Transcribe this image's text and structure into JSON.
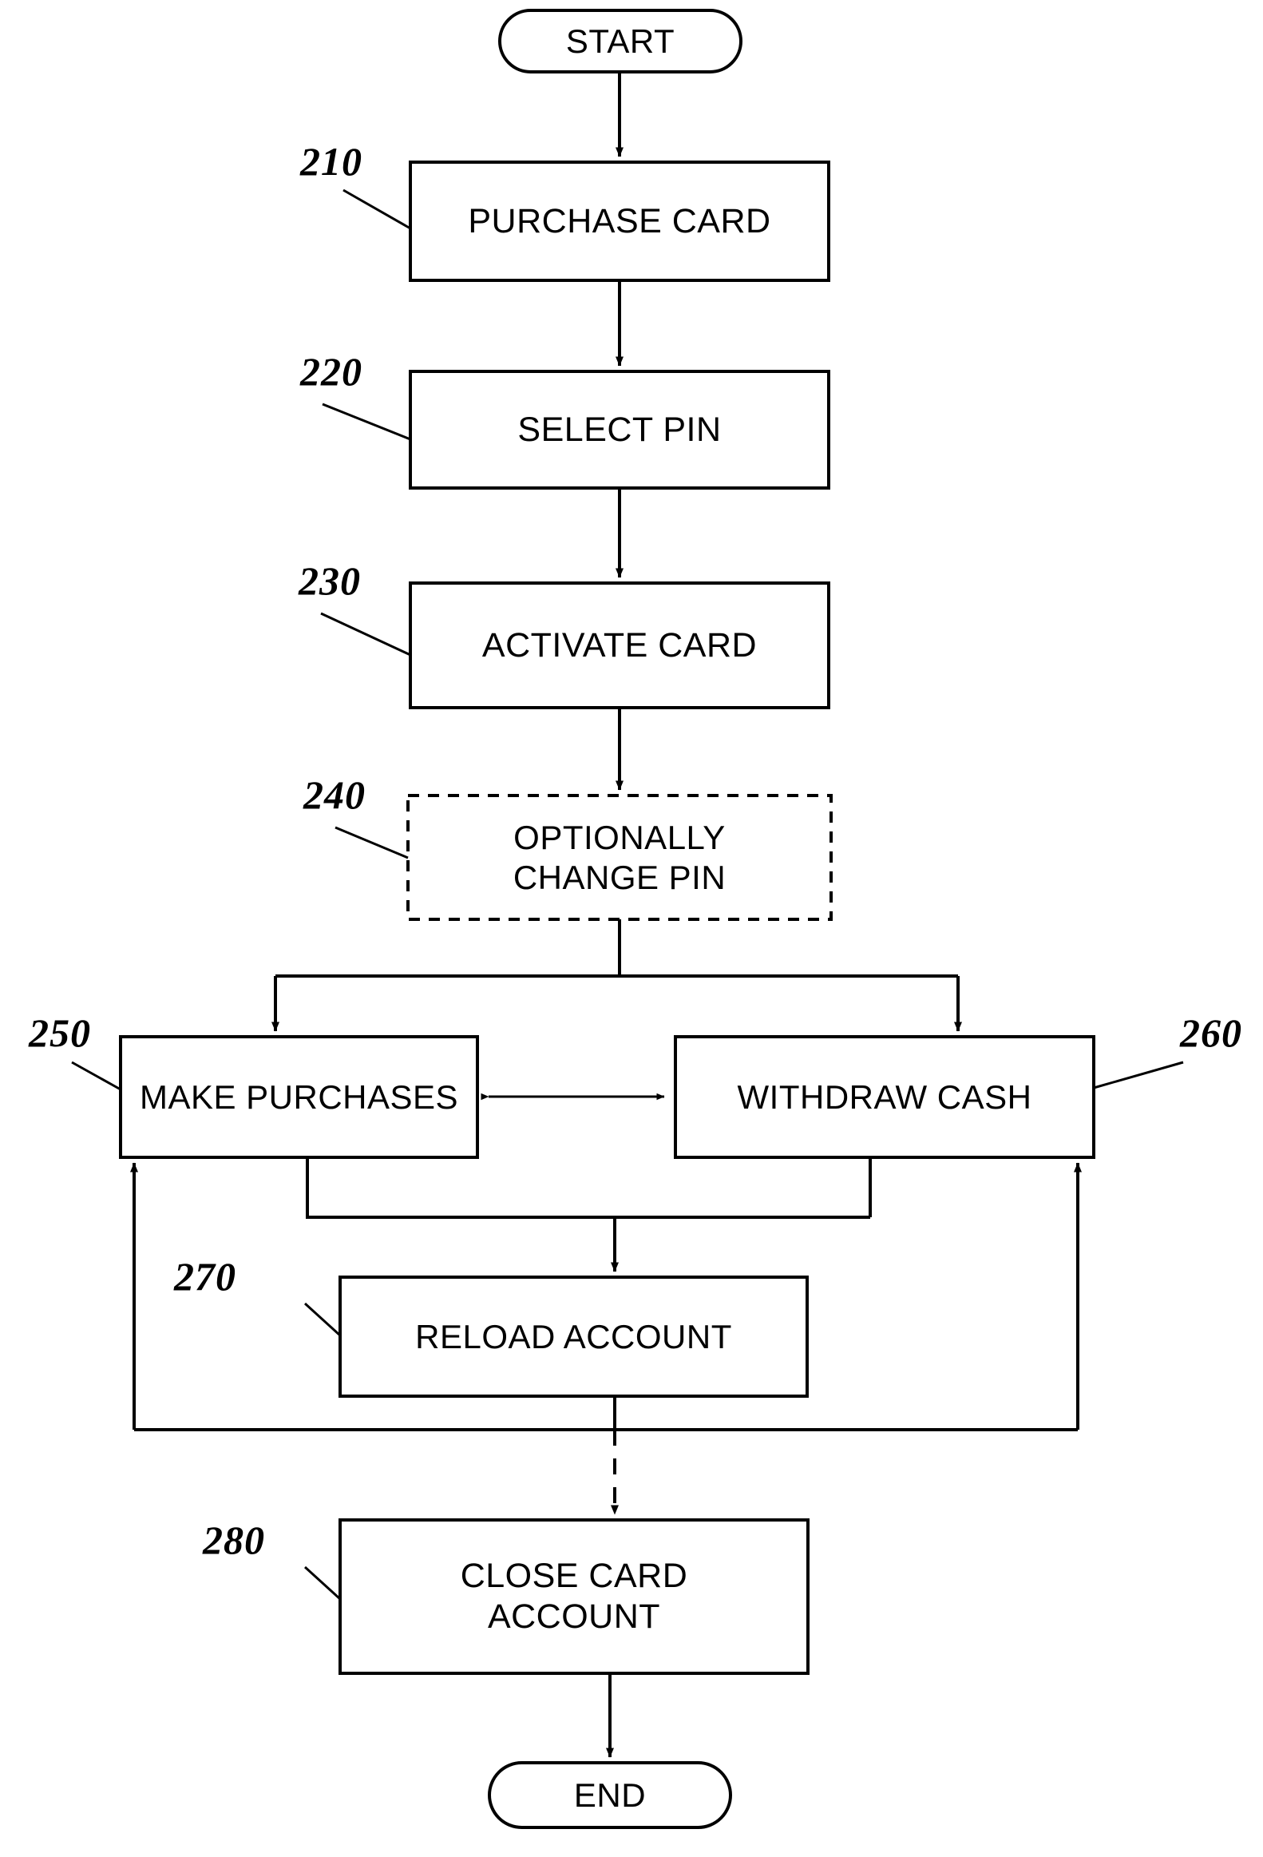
{
  "figure": {
    "type": "flowchart",
    "orientation": "vertical",
    "line_color": "#000000",
    "background_color": "#ffffff"
  },
  "nodes": {
    "start": {
      "label": "START",
      "shape": "terminator"
    },
    "n210": {
      "label": "PURCHASE CARD",
      "ref": "210",
      "shape": "process"
    },
    "n220": {
      "label": "SELECT PIN",
      "ref": "220",
      "shape": "process"
    },
    "n230": {
      "label": "ACTIVATE CARD",
      "ref": "230",
      "shape": "process"
    },
    "n240": {
      "label": "OPTIONALLY\nCHANGE PIN",
      "ref": "240",
      "shape": "process-optional-dashed"
    },
    "n250": {
      "label": "MAKE PURCHASES",
      "ref": "250",
      "shape": "process"
    },
    "n260": {
      "label": "WITHDRAW CASH",
      "ref": "260",
      "shape": "process"
    },
    "n270": {
      "label": "RELOAD ACCOUNT",
      "ref": "270",
      "shape": "process"
    },
    "n280": {
      "label": "CLOSE CARD\nACCOUNT",
      "ref": "280",
      "shape": "process"
    },
    "end": {
      "label": "END",
      "shape": "terminator"
    }
  },
  "edges": [
    {
      "from": "start",
      "to": "n210",
      "style": "solid",
      "arrow": "single"
    },
    {
      "from": "n210",
      "to": "n220",
      "style": "solid",
      "arrow": "single"
    },
    {
      "from": "n220",
      "to": "n230",
      "style": "solid",
      "arrow": "single"
    },
    {
      "from": "n230",
      "to": "n240",
      "style": "solid",
      "arrow": "single"
    },
    {
      "from": "n240",
      "to": "n250",
      "style": "solid",
      "arrow": "single"
    },
    {
      "from": "n240",
      "to": "n260",
      "style": "solid",
      "arrow": "single"
    },
    {
      "from": "n250",
      "to": "n260",
      "style": "solid",
      "arrow": "double"
    },
    {
      "from": "n250",
      "to": "n270",
      "style": "solid",
      "arrow": "single"
    },
    {
      "from": "n260",
      "to": "n270",
      "style": "solid",
      "arrow": "single"
    },
    {
      "from": "n270",
      "to": "n250",
      "style": "solid",
      "arrow": "single"
    },
    {
      "from": "n270",
      "to": "n260",
      "style": "solid",
      "arrow": "single"
    },
    {
      "from": "n270",
      "to": "n280",
      "style": "dashed",
      "arrow": "single"
    },
    {
      "from": "n280",
      "to": "end",
      "style": "solid",
      "arrow": "single"
    }
  ]
}
